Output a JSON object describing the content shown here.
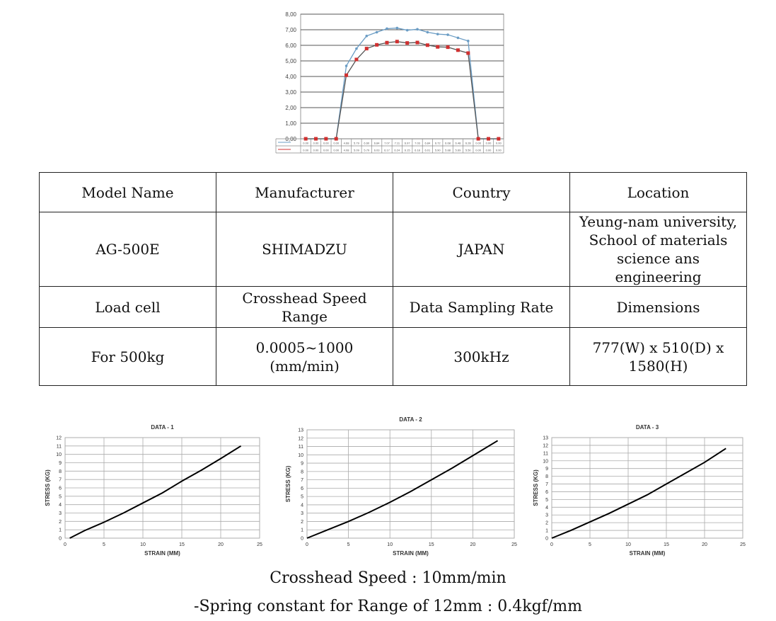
{
  "chart_data": [
    {
      "type": "line",
      "title": "",
      "ylim": [
        0,
        8
      ],
      "yticks": [
        "0,00",
        "1,00",
        "2,00",
        "3,00",
        "4,00",
        "5,00",
        "6,00",
        "7,00",
        "8,00"
      ],
      "grid": true,
      "data_table": true,
      "series": [
        {
          "color": "#6a9cc4",
          "marker": "diamond",
          "values": [
            0,
            0,
            0,
            0,
            4.68,
            5.79,
            6.6,
            6.84,
            7.07,
            7.11,
            6.97,
            7.03,
            6.84,
            6.72,
            6.68,
            6.48,
            6.28,
            0,
            0,
            0
          ]
        },
        {
          "color": "#d03030",
          "marker": "square",
          "values": [
            0,
            0,
            0,
            0,
            4.08,
            5.09,
            5.79,
            6.03,
            6.17,
            6.24,
            6.15,
            6.18,
            6.01,
            5.9,
            5.88,
            5.69,
            5.5,
            0,
            0,
            0
          ]
        }
      ]
    },
    {
      "type": "line",
      "title": "DATA - 1",
      "xlabel": "STRAIN (MM)",
      "ylabel": "STRESS (KG)",
      "xlim": [
        0,
        25
      ],
      "ylim": [
        0,
        12
      ],
      "xticks": [
        0,
        5,
        10,
        15,
        20,
        25
      ],
      "grid": true,
      "x": [
        0.6,
        2.5,
        5,
        7.5,
        10,
        12.5,
        15,
        17.5,
        20,
        22.6
      ],
      "y": [
        0,
        0.9,
        1.9,
        3.0,
        4.2,
        5.4,
        6.8,
        8.1,
        9.5,
        11.0
      ]
    },
    {
      "type": "line",
      "title": "DATA - 2",
      "xlabel": "STRAIN (MM)",
      "ylabel": "STRESS (KG)",
      "xlim": [
        0,
        25
      ],
      "ylim": [
        0,
        13
      ],
      "xticks": [
        0,
        5,
        10,
        15,
        20,
        25
      ],
      "grid": true,
      "x": [
        0,
        2.5,
        5,
        7.5,
        10,
        12.5,
        15,
        17.5,
        20,
        23
      ],
      "y": [
        0,
        1.0,
        2.0,
        3.1,
        4.3,
        5.6,
        7.0,
        8.4,
        9.9,
        11.7
      ]
    },
    {
      "type": "line",
      "title": "DATA - 3",
      "xlabel": "STRAIN (MM)",
      "ylabel": "STRESS (KG)",
      "xlim": [
        0,
        25
      ],
      "ylim": [
        0,
        13
      ],
      "xticks": [
        0,
        5,
        10,
        15,
        20,
        25
      ],
      "grid": true,
      "x": [
        0,
        2.5,
        5,
        7.5,
        10,
        12.5,
        15,
        17.5,
        20,
        22.8
      ],
      "y": [
        0,
        1.0,
        2.1,
        3.2,
        4.4,
        5.6,
        7.0,
        8.4,
        9.8,
        11.6
      ]
    }
  ],
  "spec_table": {
    "rows": [
      [
        "Model Name",
        "Manufacturer",
        "Country",
        "Location"
      ],
      [
        "AG-500E",
        "SHIMADZU",
        "JAPAN",
        "Yeung-nam university, School of materials science ans engineering"
      ],
      [
        "Load cell",
        "Crosshead Speed Range",
        "Data Sampling Rate",
        "Dimensions"
      ],
      [
        "For 500kg",
        "0.0005~1000 (mm/min)",
        "300kHz",
        "777(W) x 510(D) x 1580(H)"
      ]
    ]
  },
  "captions": {
    "line1": "Crosshead Speed : 10mm/min",
    "line2": "-Spring constant for Range of 12mm : 0.4kgf/mm"
  }
}
